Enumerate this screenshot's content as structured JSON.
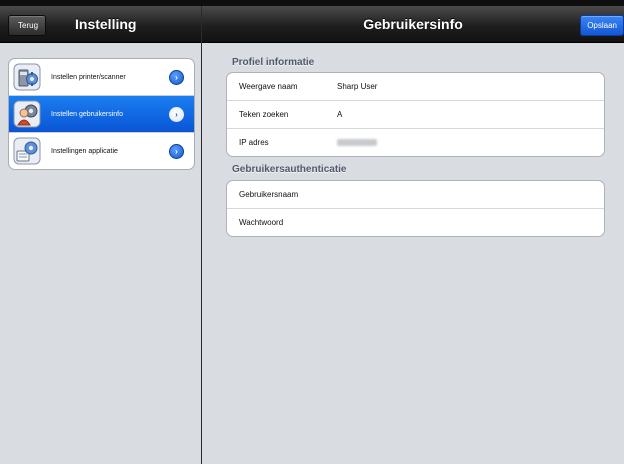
{
  "left_nav": {
    "back_label": "Terug",
    "title": "Instelling"
  },
  "menu": {
    "items": [
      {
        "label": "Instellen printer/scanner",
        "icon": "printer-scanner-icon",
        "selected": false
      },
      {
        "label": "Instellen gebruikersinfo",
        "icon": "user-settings-icon",
        "selected": true
      },
      {
        "label": "Instellingen applicatie",
        "icon": "app-settings-icon",
        "selected": false
      }
    ]
  },
  "right_nav": {
    "title": "Gebruikersinfo",
    "save_label": "Opslaan"
  },
  "profile": {
    "section_title": "Profiel informatie",
    "rows": [
      {
        "label": "Weergave naam",
        "value": "Sharp User"
      },
      {
        "label": "Teken zoeken",
        "value": "A"
      },
      {
        "label": "IP adres",
        "value": ""
      }
    ]
  },
  "auth": {
    "section_title": "Gebruikersauthenticatie",
    "rows": [
      {
        "label": "Gebruikersnaam",
        "value": ""
      },
      {
        "label": "Wachtwoord",
        "value": ""
      }
    ]
  },
  "colors": {
    "accent": "#0a55d6",
    "nav_bar": "#1f1f1f",
    "background": "#d9dce1"
  }
}
